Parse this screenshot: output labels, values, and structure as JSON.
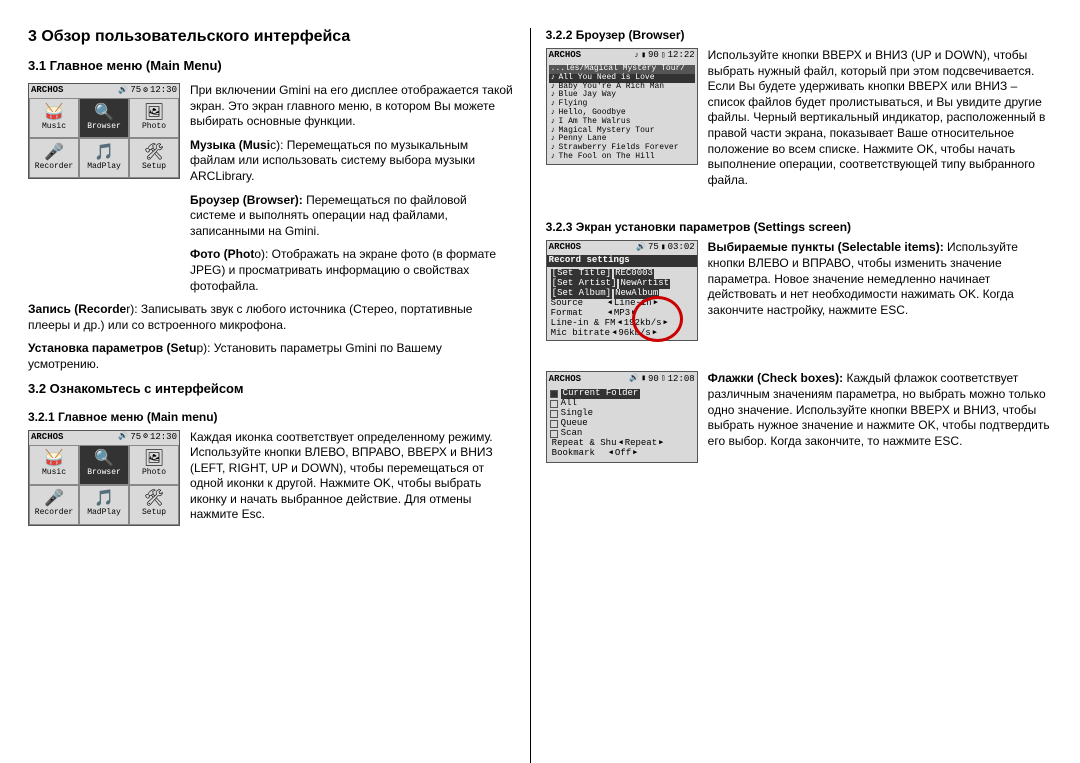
{
  "title": "3 Обзор пользовательского интерфейса",
  "left": {
    "h2_1": "3.1 Главное меню (Main Menu)",
    "p1": "При включении Gmini на его дисплее отображается такой экран. Это экран главного меню, в котором Вы можете выбирать основные функции.",
    "music_b": "Музыка (Musi",
    "music_t": "c): Перемещаться по музыкальным файлам или использовать систему выбора музыки ARCLibrary.",
    "browser_b": "Броузер (Browser):",
    "browser_t": " Перемещаться по файловой системе и выполнять операции над файлами, записанными на Gmini.",
    "photo_b": "Фото (Phot",
    "photo_t": "o): Отображать на экране фото (в формате JPEG) и просматривать информацию о свойствах фотофайла.",
    "rec_b": "Запись (Recorde",
    "rec_t": "r): Записывать звук с любого источника (Стерео, портативные плееры и др.) или со встроенного микрофона.",
    "setup_b": "Установка параметров (Setu",
    "setup_t": "p): Установить параметры Gmini по Вашему усмотрению.",
    "h2_2": "3.2 Ознакомьтесь с интерфейсом",
    "h3_1": "3.2.1 Главное меню (Main menu)",
    "p2": "Каждая иконка соответствует определенному режиму. Используйте кнопки ВЛЕВО, ВПРАВО, ВВЕРХ и ВНИЗ (LEFT, RIGHT, UP и DOWN), чтобы перемещаться от одной иконки к другой. Нажмите OK, чтобы выбрать иконку и начать выбранное действие. Для отмены нажмите Esc."
  },
  "right": {
    "h3_1": "3.2.2 Броузер (Browser)",
    "p1": "Используйте кнопки ВВЕРХ и ВНИЗ (UP и DOWN), чтобы выбрать нужный файл, который при этом подсвечивается. Если Вы будете удерживать кнопки ВВЕРХ или ВНИЗ – список файлов будет пролистываться, и Вы увидите другие файлы. Черный вертикальный индикатор, расположенный в правой части экрана, показывает Ваше относительное положение во всем списке. Нажмите OK, чтобы начать выполнение операции, соответствующей типу выбранного файла.",
    "h3_2": "3.2.3 Экран установки параметров (Settings screen)",
    "sel_b": "Выбираемые пункты (Selectable items):",
    "sel_t": " Используйте кнопки ВЛЕВО и ВПРАВО, чтобы изменить значение параметра. Новое значение немедленно начинает действовать и нет необходимости нажимать OK. Когда закончите настройку, нажмите ESC.",
    "chk_b": "Флажки (Check boxes):",
    "chk_t": " Каждый флажок соответствует различным значениям параметра, но выбрать можно только одно значение. Используйте кнопки ВВЕРХ и ВНИЗ, чтобы выбрать нужное значение и нажмите OK, чтобы подтвердить его выбор. Когда закончите, то нажмите ESC."
  },
  "dev_main": {
    "brand": "ARCHOS",
    "status": "75",
    "time": "12:30",
    "cells": [
      {
        "glyph": "🥁",
        "lbl": "Music"
      },
      {
        "glyph": "🔍",
        "lbl": "Browser",
        "sel": true
      },
      {
        "glyph": "🖼",
        "lbl": "Photo"
      },
      {
        "glyph": "🎤",
        "lbl": "Recorder"
      },
      {
        "glyph": "🎵",
        "lbl": "MadPlay"
      },
      {
        "glyph": "🛠",
        "lbl": "Setup"
      }
    ]
  },
  "dev_browser": {
    "brand": "ARCHOS",
    "bat": "90",
    "time": "12:22",
    "path": "...les/Magical Mystery Tour/",
    "items": [
      {
        "t": "All You Need is Love",
        "sel": true
      },
      {
        "t": "Baby You're A Rich Man"
      },
      {
        "t": "Blue Jay Way"
      },
      {
        "t": "Flying"
      },
      {
        "t": "Hello, Goodbye"
      },
      {
        "t": "I Am The Walrus"
      },
      {
        "t": "Magical Mystery Tour"
      },
      {
        "t": "Penny Lane"
      },
      {
        "t": "Strawberry Fields Forever"
      },
      {
        "t": "The Fool on The Hill"
      }
    ]
  },
  "dev_rec": {
    "brand": "ARCHOS",
    "bat": "75",
    "time": "03:02",
    "header": "Record settings",
    "rows": [
      {
        "k": "[Set Title]",
        "v": "REC0003"
      },
      {
        "k": "[Set Artist]",
        "v": "NewArtist"
      },
      {
        "k": "[Set Album]",
        "v": "NewAlbum"
      },
      {
        "k": "Source",
        "v": "Line-in",
        "arr": true
      },
      {
        "k": "Format",
        "v": "MP3",
        "arr": true
      },
      {
        "k": "Line-in & FM",
        "v": "192kb/s",
        "arr": true
      },
      {
        "k": "Mic bitrate",
        "v": "96kb/s",
        "arr": true
      }
    ]
  },
  "dev_play": {
    "brand": "ARCHOS",
    "bat": "90",
    "time": "12:08",
    "opts": [
      "Current Folder",
      "All",
      "Single",
      "Queue",
      "Scan"
    ],
    "bottom": [
      {
        "k": "Repeat & Shu",
        "v": "Repeat"
      },
      {
        "k": "Bookmark",
        "v": "Off"
      }
    ]
  }
}
